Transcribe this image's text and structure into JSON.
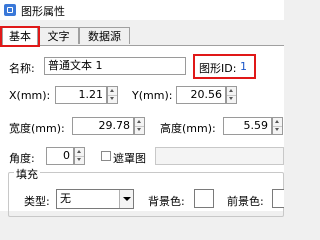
{
  "window": {
    "title": "图形属性"
  },
  "tabs": [
    "基本",
    "文字",
    "数据源"
  ],
  "basic": {
    "name_label": "名称:",
    "name_value": "普通文本 1",
    "id_label": "图形ID:",
    "id_value": "1",
    "x_label": "X(mm):",
    "x_value": "1.21",
    "y_label": "Y(mm):",
    "y_value": "20.56",
    "width_label": "宽度(mm):",
    "width_value": "29.78",
    "height_label": "高度(mm):",
    "height_value": "5.59",
    "angle_label": "角度:",
    "angle_value": "0",
    "mask_label": "遮罩图"
  },
  "fill": {
    "group_label": "填充",
    "type_label": "类型:",
    "type_value": "无",
    "bg_color_label": "背景色:",
    "fg_color_label": "前景色:"
  },
  "colors": {
    "highlight": "#e01818",
    "id_text": "#1a56c8",
    "icon": "#3a78d8"
  }
}
